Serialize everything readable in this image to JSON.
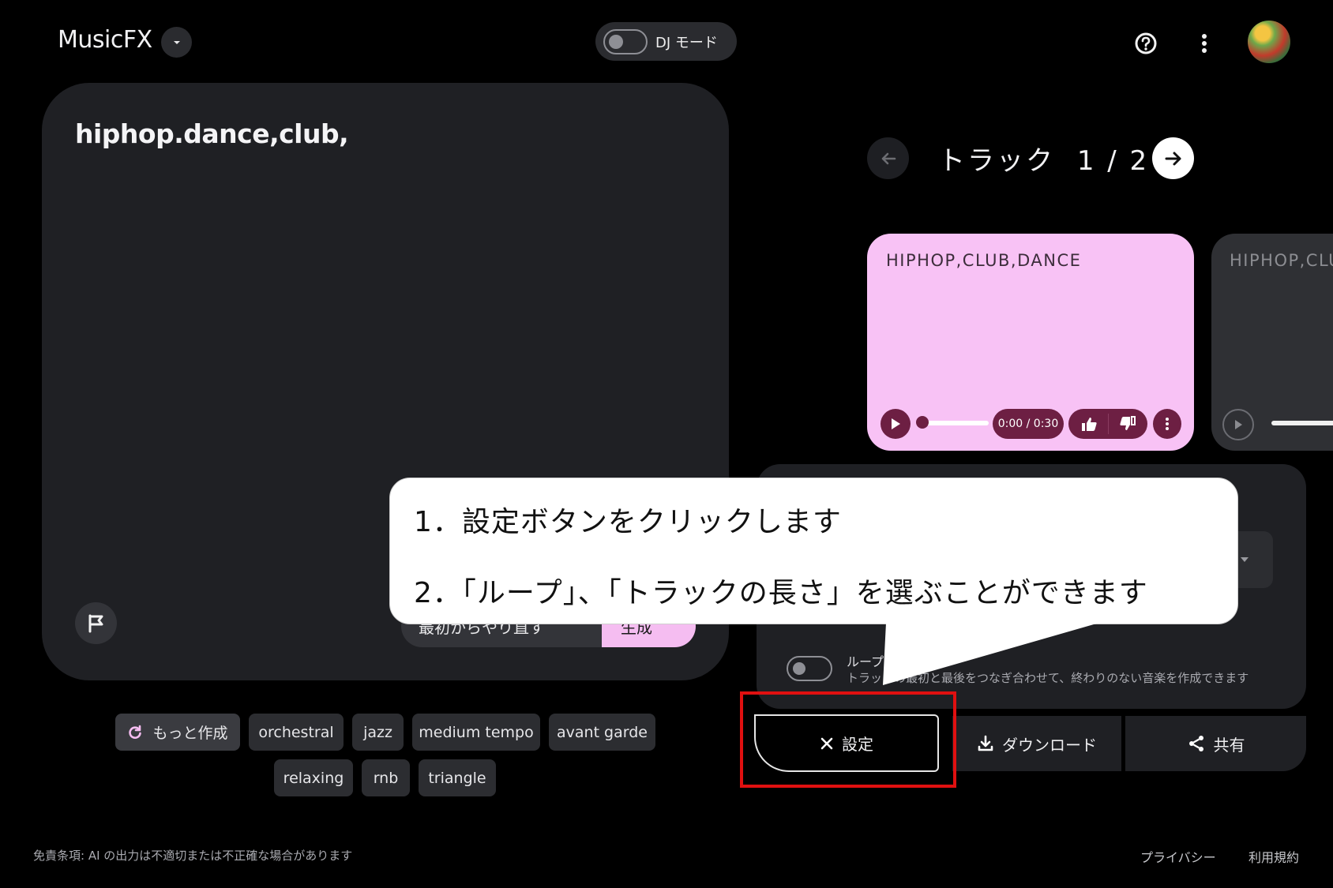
{
  "header": {
    "app_name": "MusicFX",
    "dj_mode_label": "DJ モード",
    "icons": [
      "help-icon",
      "more-vert-icon",
      "chevron-down-icon"
    ]
  },
  "prompt": {
    "text": "hiphop.dance,club,",
    "restart_label": "最初からやり直す",
    "create_label": "生成"
  },
  "chips": {
    "more_label": "もっと作成",
    "row1": [
      "orchestral",
      "jazz",
      "medium tempo",
      "avant garde"
    ],
    "row2": [
      "relaxing",
      "rnb",
      "triangle"
    ]
  },
  "tracks": {
    "title": "トラック",
    "counter": "1 / 2",
    "card1": {
      "title": "HIPHOP,CLUB,DANCE",
      "time": "0:00 / 0:30",
      "progress": 0
    },
    "card2": {
      "title": "HIPHOP,CLU"
    }
  },
  "settings": {
    "loop_label": "ループ",
    "loop_desc": "トラックの最初と最後をつなぎ合わせて、終わりのない音楽を作成できます",
    "loop_on": false
  },
  "actions": {
    "settings_label": "設定",
    "download_label": "ダウンロード",
    "share_label": "共有"
  },
  "callout": {
    "line1": "1．設定ボタンをクリックします",
    "line2": "2．「ループ」、「トラックの長さ」を選ぶことができます"
  },
  "footer": {
    "disclaimer": "免責条項: AI の出力は不適切または不正確な場合があります",
    "privacy": "プライバシー",
    "terms": "利用規約"
  },
  "colors": {
    "accent_pink": "#f8c2f5",
    "card_controls": "#6d1f43",
    "annotation_red": "#e01010"
  }
}
